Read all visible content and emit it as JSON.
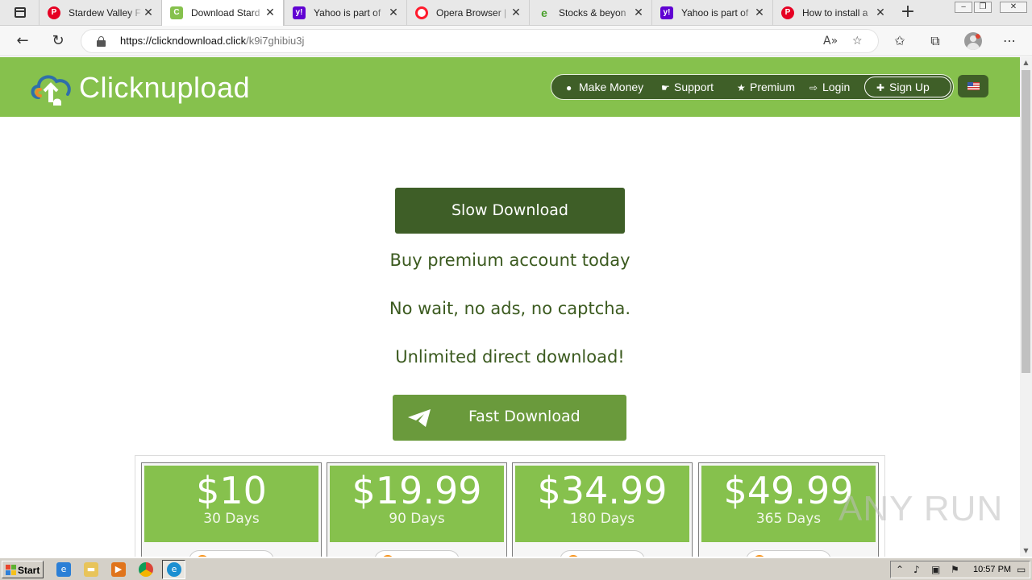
{
  "browser": {
    "tabs": [
      {
        "title": "Stardew Valley F",
        "favicon": "pinterest-icon",
        "color": "#e60023",
        "active": false
      },
      {
        "title": "Download Stard",
        "favicon": "clicknupload-icon",
        "color": "#86c14d",
        "active": true
      },
      {
        "title": "Yahoo is part of",
        "favicon": "yahoo-icon",
        "color": "#6001d2",
        "active": false
      },
      {
        "title": "Opera Browser |",
        "favicon": "opera-icon",
        "color": "#ff1b2d",
        "active": false
      },
      {
        "title": "Stocks & beyon",
        "favicon": "etrade-icon",
        "color": "#6cbf3b",
        "active": false
      },
      {
        "title": "Yahoo is part of",
        "favicon": "yahoo-icon",
        "color": "#6001d2",
        "active": false
      },
      {
        "title": "How to install a",
        "favicon": "pinterest-icon",
        "color": "#e60023",
        "active": false
      }
    ],
    "url_host": "https://clickndownload.click",
    "url_path": "/k9i7ghibiu3j"
  },
  "site": {
    "logo_text": "Clicknupload",
    "nav": {
      "make_money": "Make Money",
      "support": "Support",
      "premium": "Premium",
      "login": "Login",
      "signup": "Sign Up"
    },
    "slow_download": "Slow Download",
    "promo_lines": [
      "Buy premium account today",
      "No wait, no ads, no captcha.",
      "Unlimited direct download!"
    ],
    "fast_download": "Fast Download",
    "plans": [
      {
        "price": "$10",
        "days": "30 Days"
      },
      {
        "price": "$19.99",
        "days": "90 Days"
      },
      {
        "price": "$34.99",
        "days": "180 Days"
      },
      {
        "price": "$49.99",
        "days": "365 Days"
      }
    ],
    "colors": {
      "brand_green": "#86c14d",
      "dark_green": "#3e5e27",
      "button_green": "#6a9a3c",
      "text_green": "#3b5a1f"
    }
  },
  "watermark": "ANY RUN",
  "taskbar": {
    "start_label": "Start",
    "clock": "10:57 PM"
  }
}
